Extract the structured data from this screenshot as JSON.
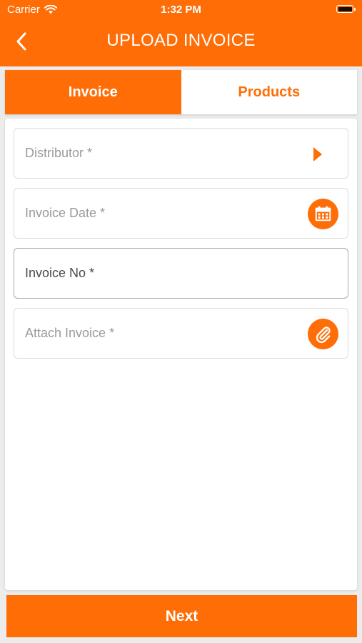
{
  "status_bar": {
    "carrier": "Carrier",
    "time": "1:32 PM"
  },
  "header": {
    "title": "UPLOAD INVOICE",
    "back_icon": "chevron-left-icon"
  },
  "tabs": [
    {
      "label": "Invoice",
      "active": true
    },
    {
      "label": "Products",
      "active": false
    }
  ],
  "form": {
    "distributor": {
      "label": "Distributor *",
      "icon": "caret-right-icon"
    },
    "invoice_date": {
      "label": "Invoice Date *",
      "icon": "calendar-icon"
    },
    "invoice_no": {
      "label": "Invoice No *",
      "focused": true
    },
    "attach_invoice": {
      "label": "Attach Invoice *",
      "icon": "paperclip-icon"
    }
  },
  "footer": {
    "next_label": "Next"
  },
  "colors": {
    "accent": "#fe6d06",
    "background": "#ececec",
    "label_gray": "#9a9a9a"
  }
}
